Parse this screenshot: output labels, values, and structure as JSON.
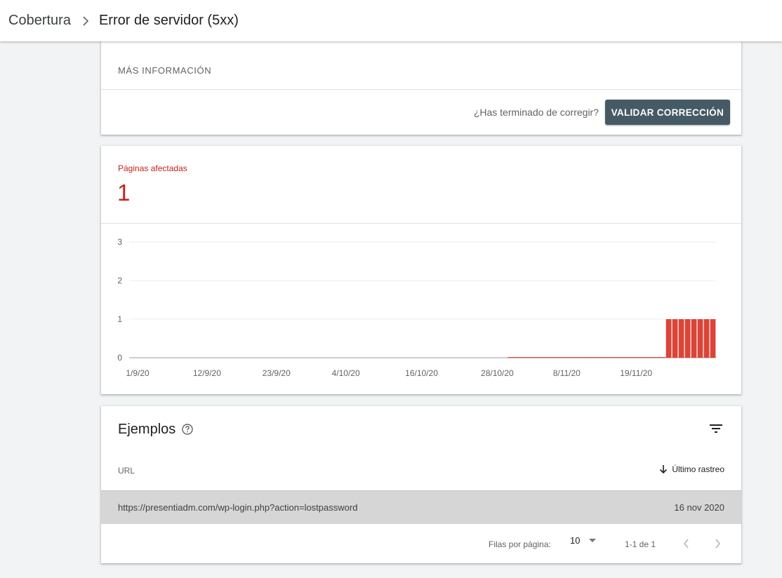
{
  "breadcrumb": {
    "parent": "Cobertura",
    "current": "Error de servidor (5xx)"
  },
  "more_info": {
    "label": "MÁS INFORMACIÓN"
  },
  "validation": {
    "question": "¿Has terminado de corregir?",
    "button_label": "VALIDAR CORRECCIÓN"
  },
  "summary": {
    "label": "Páginas afectadas",
    "value": "1"
  },
  "chart_data": {
    "type": "bar",
    "ylim": [
      0,
      3
    ],
    "y_ticks": [
      "0",
      "1",
      "2",
      "3"
    ],
    "x_tick_labels": [
      "1/9/20",
      "12/9/20",
      "23/9/20",
      "4/10/20",
      "16/10/20",
      "28/10/20",
      "8/11/20",
      "19/11/20"
    ],
    "x_start_label": "1/9/20",
    "color": "#db4437",
    "days": 93,
    "values": [
      0,
      0,
      0,
      0,
      0,
      0,
      0,
      0,
      0,
      0,
      0,
      0,
      0,
      0,
      0,
      0,
      0,
      0,
      0,
      0,
      0,
      0,
      0,
      0,
      0,
      0,
      0,
      0,
      0,
      0,
      0,
      0,
      0,
      0,
      0,
      0,
      0,
      0,
      0,
      0,
      0,
      0,
      0,
      0,
      0,
      0,
      0,
      0,
      0,
      0,
      0,
      0,
      0,
      0,
      0,
      0,
      0,
      0,
      0,
      0,
      0,
      0,
      0,
      0,
      0,
      0,
      0,
      0,
      0,
      0,
      0,
      0,
      0,
      0,
      0,
      0,
      0,
      0,
      0,
      0,
      0,
      0,
      0,
      0,
      0,
      1,
      1,
      1,
      1,
      1,
      1,
      1,
      1
    ],
    "grid": true
  },
  "examples": {
    "title": "Ejemplos",
    "col_url": "URL",
    "col_last_crawl": "Último rastreo",
    "rows": [
      {
        "url": "https://presentiadm.com/wp-login.php?action=lostpassword",
        "date": "16 nov 2020"
      }
    ],
    "pagination": {
      "rows_per_page_label": "Filas por página:",
      "rows_per_page": "10",
      "range": "1-1 de 1"
    }
  }
}
